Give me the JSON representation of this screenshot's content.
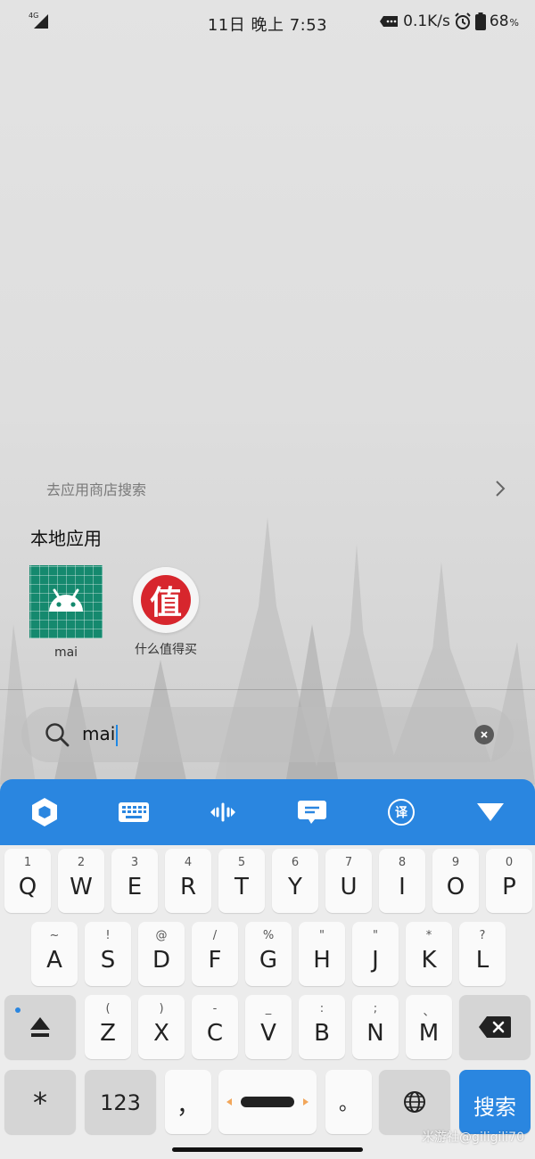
{
  "status_bar": {
    "net_type": "4G",
    "time": "11日 晚上 7:53",
    "speed": "0.1K/s",
    "battery_percent": "68",
    "battery_unit": "%"
  },
  "results": {
    "store_search_label": "去应用商店搜索",
    "section_title": "本地应用",
    "apps": [
      {
        "label": "mai",
        "icon": "android-icon"
      },
      {
        "label": "什么值得买",
        "icon": "smzdm-icon",
        "glyph": "值"
      }
    ]
  },
  "search": {
    "query": "mai",
    "clear_icon": "clear-icon"
  },
  "keyboard": {
    "toolbar_icons": [
      "hexagon-icon",
      "keyboard-icon",
      "voice-icon",
      "message-icon",
      "translate-icon",
      "collapse-icon"
    ],
    "translate_glyph": "译",
    "row1": [
      {
        "sub": "1",
        "main": "Q"
      },
      {
        "sub": "2",
        "main": "W"
      },
      {
        "sub": "3",
        "main": "E"
      },
      {
        "sub": "4",
        "main": "R"
      },
      {
        "sub": "5",
        "main": "T"
      },
      {
        "sub": "6",
        "main": "Y"
      },
      {
        "sub": "7",
        "main": "U"
      },
      {
        "sub": "8",
        "main": "I"
      },
      {
        "sub": "9",
        "main": "O"
      },
      {
        "sub": "0",
        "main": "P"
      }
    ],
    "row2": [
      {
        "sub": "~",
        "main": "A"
      },
      {
        "sub": "!",
        "main": "S"
      },
      {
        "sub": "@",
        "main": "D"
      },
      {
        "sub": "/",
        "main": "F"
      },
      {
        "sub": "%",
        "main": "G"
      },
      {
        "sub": "\"",
        "main": "H"
      },
      {
        "sub": "\"",
        "main": "J"
      },
      {
        "sub": "*",
        "main": "K"
      },
      {
        "sub": "?",
        "main": "L"
      }
    ],
    "row3": [
      {
        "sub": "(",
        "main": "Z"
      },
      {
        "sub": ")",
        "main": "X"
      },
      {
        "sub": "-",
        "main": "C"
      },
      {
        "sub": "_",
        "main": "V"
      },
      {
        "sub": ":",
        "main": "B"
      },
      {
        "sub": ";",
        "main": "N"
      },
      {
        "sub": "、",
        "main": "M"
      }
    ],
    "bottom": {
      "star": "*",
      "num_label": "123",
      "comma": "，",
      "period": "。",
      "search_label": "搜索"
    }
  },
  "watermark": "米游社@giligili70"
}
